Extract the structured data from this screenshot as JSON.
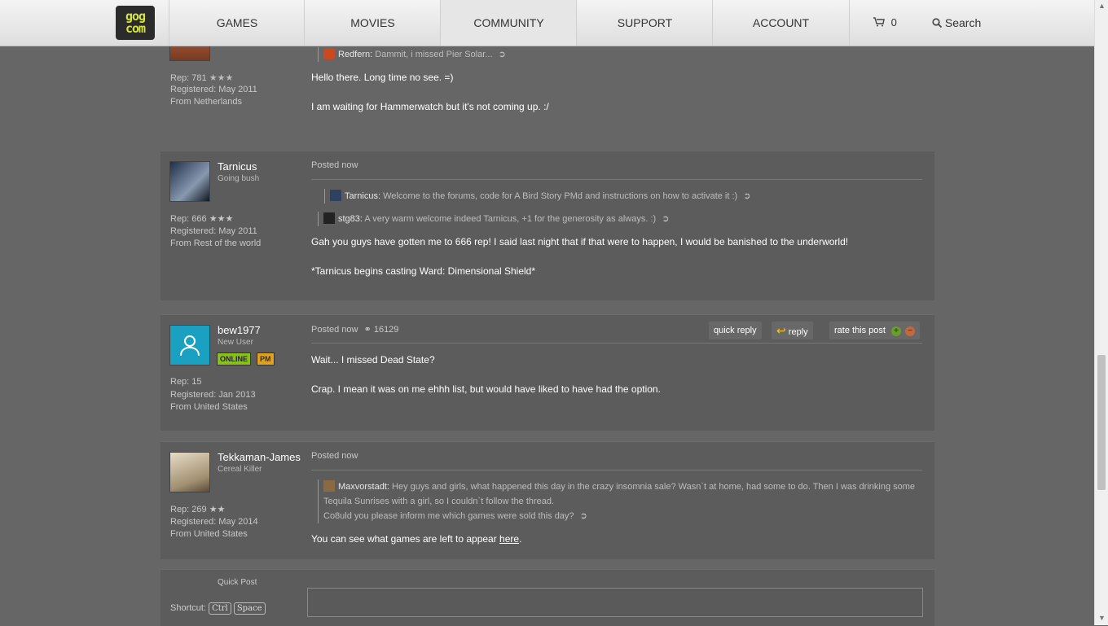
{
  "nav": {
    "logo": "gog com",
    "items": [
      "GAMES",
      "MOVIES",
      "COMMUNITY",
      "SUPPORT",
      "ACCOUNT"
    ],
    "cart_count": "0",
    "search_label": "Search"
  },
  "posts": [
    {
      "rep": "Rep: 781",
      "stars": "★★★",
      "registered": "Registered: May 2011",
      "from": "From Netherlands",
      "quotes": [
        {
          "name": "Redfern:",
          "text": "Dammit, i missed Pier Solar..."
        }
      ],
      "lines": [
        "Hello there. Long time no see. =)",
        "I am waiting for Hammerwatch but it's not coming up. :/"
      ]
    },
    {
      "username": "Tarnicus",
      "user_title": "Going bush",
      "rep": "Rep: 666",
      "stars": "★★★",
      "registered": "Registered: May 2011",
      "from": "From Rest of the world",
      "posted": "Posted now",
      "quotes": [
        {
          "name": "Tarnicus:",
          "text": "Welcome to the forums, code for A Bird Story PMd and instructions on how to activate it :)"
        },
        {
          "name": "stg83:",
          "text": "A very warm welcome indeed Tarnicus, +1 for the generosity as always. :)"
        }
      ],
      "lines": [
        "Gah you guys have gotten me to 666 rep! I said last night that if that were to happen, I would be banished to the underworld!",
        "*Tarnicus begins casting Ward: Dimensional Shield*"
      ]
    },
    {
      "username": "bew1977",
      "user_title": "New User",
      "online": "ONLINE",
      "pm": "PM",
      "rep": "Rep: 15",
      "registered": "Registered: Jan 2013",
      "from": "From United States",
      "posted": "Posted now",
      "post_id": "16129",
      "quick_reply": "quick reply",
      "reply": "reply",
      "rate": "rate this post",
      "lines": [
        "Wait... I missed Dead State?",
        "Crap. I mean it was on me ehhh list, but would have liked to have had the option."
      ]
    },
    {
      "username": "Tekkaman-James",
      "user_title": "Cereal Killer",
      "rep": "Rep: 269",
      "stars": "★★",
      "registered": "Registered: May 2014",
      "from": "From United States",
      "posted": "Posted now",
      "quote_name": "Maxvorstadt:",
      "quote_lines": [
        "Hey guys and girls, what happened this day in the crazy insomnia sale? Wasn`t at home, had some to do. Then I was drinking some",
        "Tequila Sunrises with a girl, so I couldn`t follow the thread.",
        "Co8uld you please inform me which games were sold this day?"
      ],
      "line_before_link": "You can see what games are left to appear ",
      "link": "here",
      "line_after_link": "."
    }
  ],
  "quick_post": {
    "title": "Quick Post",
    "shortcut_label": "Shortcut:",
    "key1": "Ctrl",
    "key2": "Space"
  },
  "colors": {
    "online": "#8bbf1a",
    "pm": "#e0a020",
    "bew_avatar": "#1aa0c0"
  }
}
